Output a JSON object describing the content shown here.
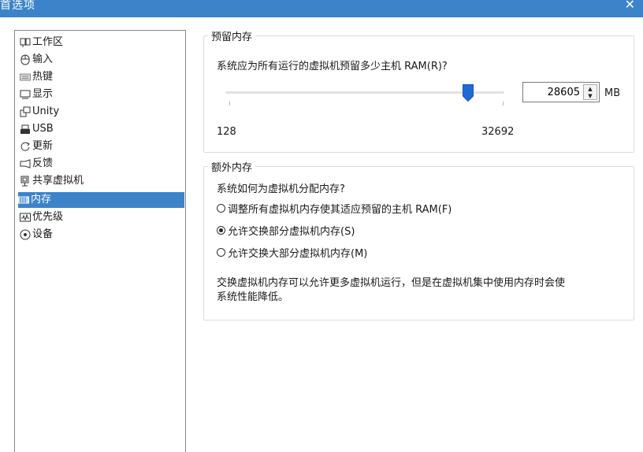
{
  "window": {
    "title": "首选项",
    "close_glyph": "✕"
  },
  "nav": {
    "items": [
      {
        "label": "工作区",
        "icon": "workspace-icon"
      },
      {
        "label": "输入",
        "icon": "mouse-icon"
      },
      {
        "label": "热键",
        "icon": "keyboard-icon"
      },
      {
        "label": "显示",
        "icon": "monitor-icon"
      },
      {
        "label": "Unity",
        "icon": "unity-icon"
      },
      {
        "label": "USB",
        "icon": "usb-icon"
      },
      {
        "label": "更新",
        "icon": "refresh-icon"
      },
      {
        "label": "反馈",
        "icon": "feedback-icon"
      },
      {
        "label": "共享虚拟机",
        "icon": "shared-vm-icon"
      },
      {
        "label": "内存",
        "icon": "memory-icon"
      },
      {
        "label": "优先级",
        "icon": "priority-icon"
      },
      {
        "label": "设备",
        "icon": "device-icon"
      }
    ],
    "selected": "内存"
  },
  "reserved": {
    "title": "预留内存",
    "question": "系统应为所有运行的虚拟机预留多少主机 RAM(R)?",
    "value": "28605",
    "unit": "MB",
    "min_label": "128",
    "max_label": "32692",
    "slider": {
      "min": 128,
      "max": 32692,
      "value": 28605
    }
  },
  "extra": {
    "title": "额外内存",
    "question": "系统如何为虚拟机分配内存?",
    "options": [
      {
        "label": "调整所有虚拟机内存使其适应预留的主机 RAM(F)",
        "checked": false
      },
      {
        "label": "允许交换部分虚拟机内存(S)",
        "checked": true
      },
      {
        "label": "允许交换大部分虚拟机内存(M)",
        "checked": false
      }
    ],
    "note_line1": "交换虚拟机内存可以允许更多虚拟机运行，但是在虚拟机集中使用内存时会使",
    "note_line2": "系统性能降低。"
  },
  "colors": {
    "accent": "#3c83c9",
    "thumb": "#1e6bd6"
  }
}
